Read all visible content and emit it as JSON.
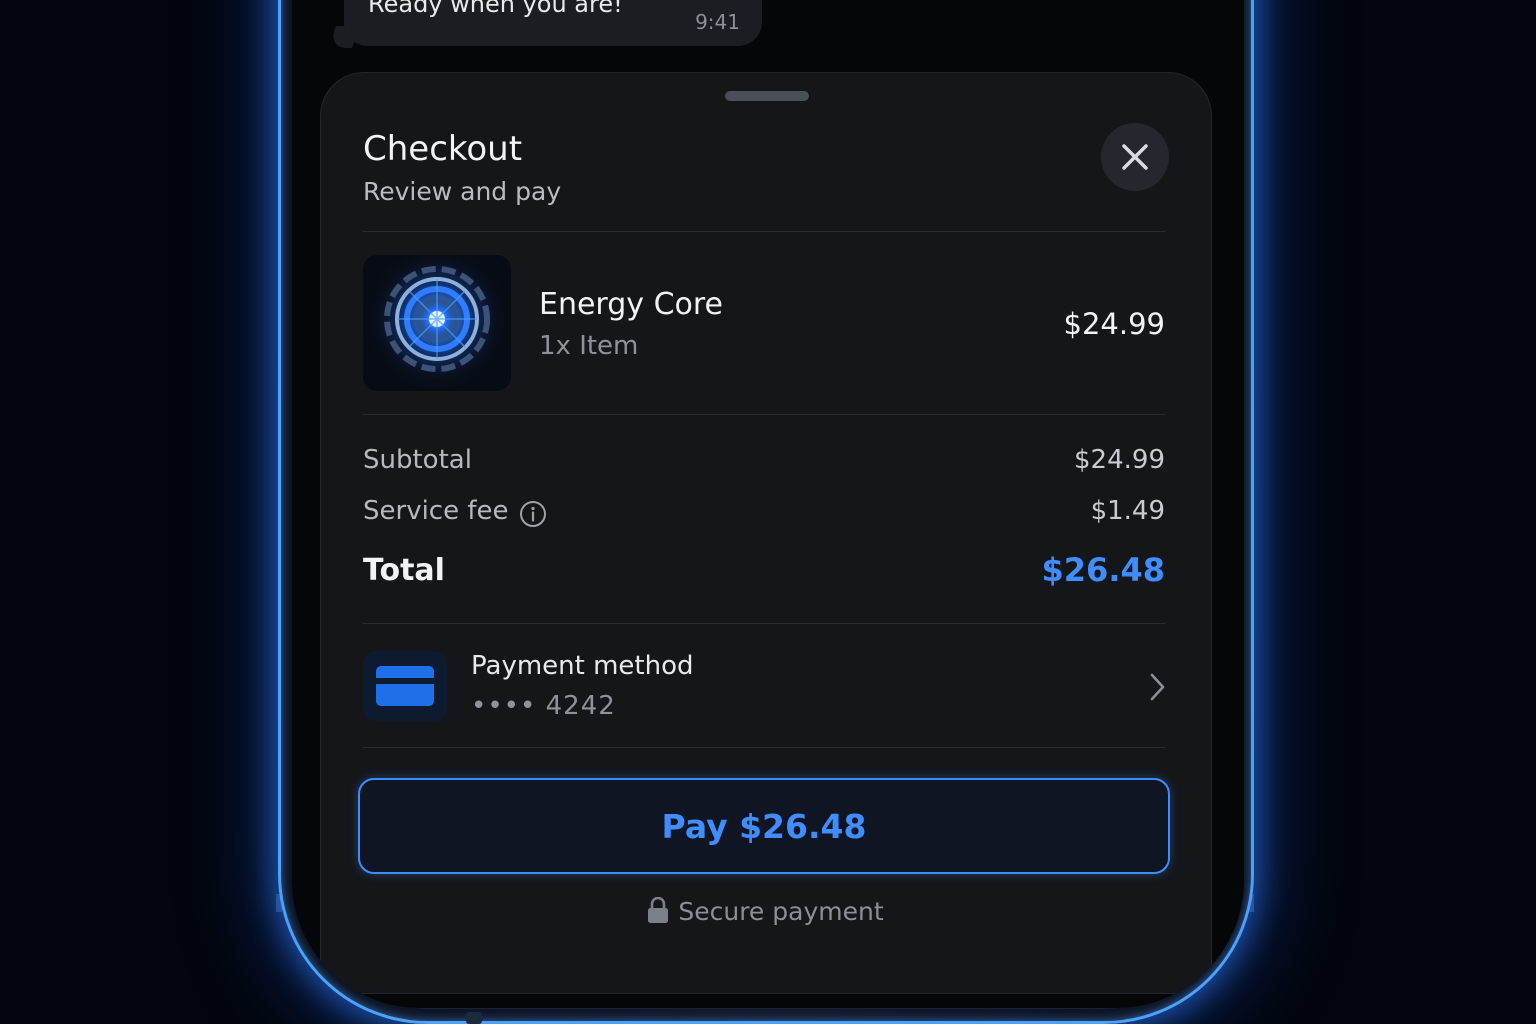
{
  "chat": {
    "message": "Ready when you are!",
    "time": "9:41"
  },
  "checkout": {
    "title": "Checkout",
    "subtitle": "Review and pay",
    "item": {
      "name": "Energy Core",
      "quantity": "1x Item",
      "price": "$24.99",
      "image_icon": "energy-core-image"
    },
    "summary": {
      "subtotal_label": "Subtotal",
      "subtotal_value": "$24.99",
      "fee_label": "Service fee",
      "fee_value": "$1.49",
      "total_label": "Total",
      "total_value": "$26.48"
    },
    "payment": {
      "label": "Payment method",
      "masked_card": "•••• 4242"
    },
    "pay_button": "Pay $26.48",
    "secure_text": "Secure payment"
  },
  "colors": {
    "accent": "#3f8dff",
    "sheet_bg": "#141619",
    "glow": "#2e80ff"
  }
}
